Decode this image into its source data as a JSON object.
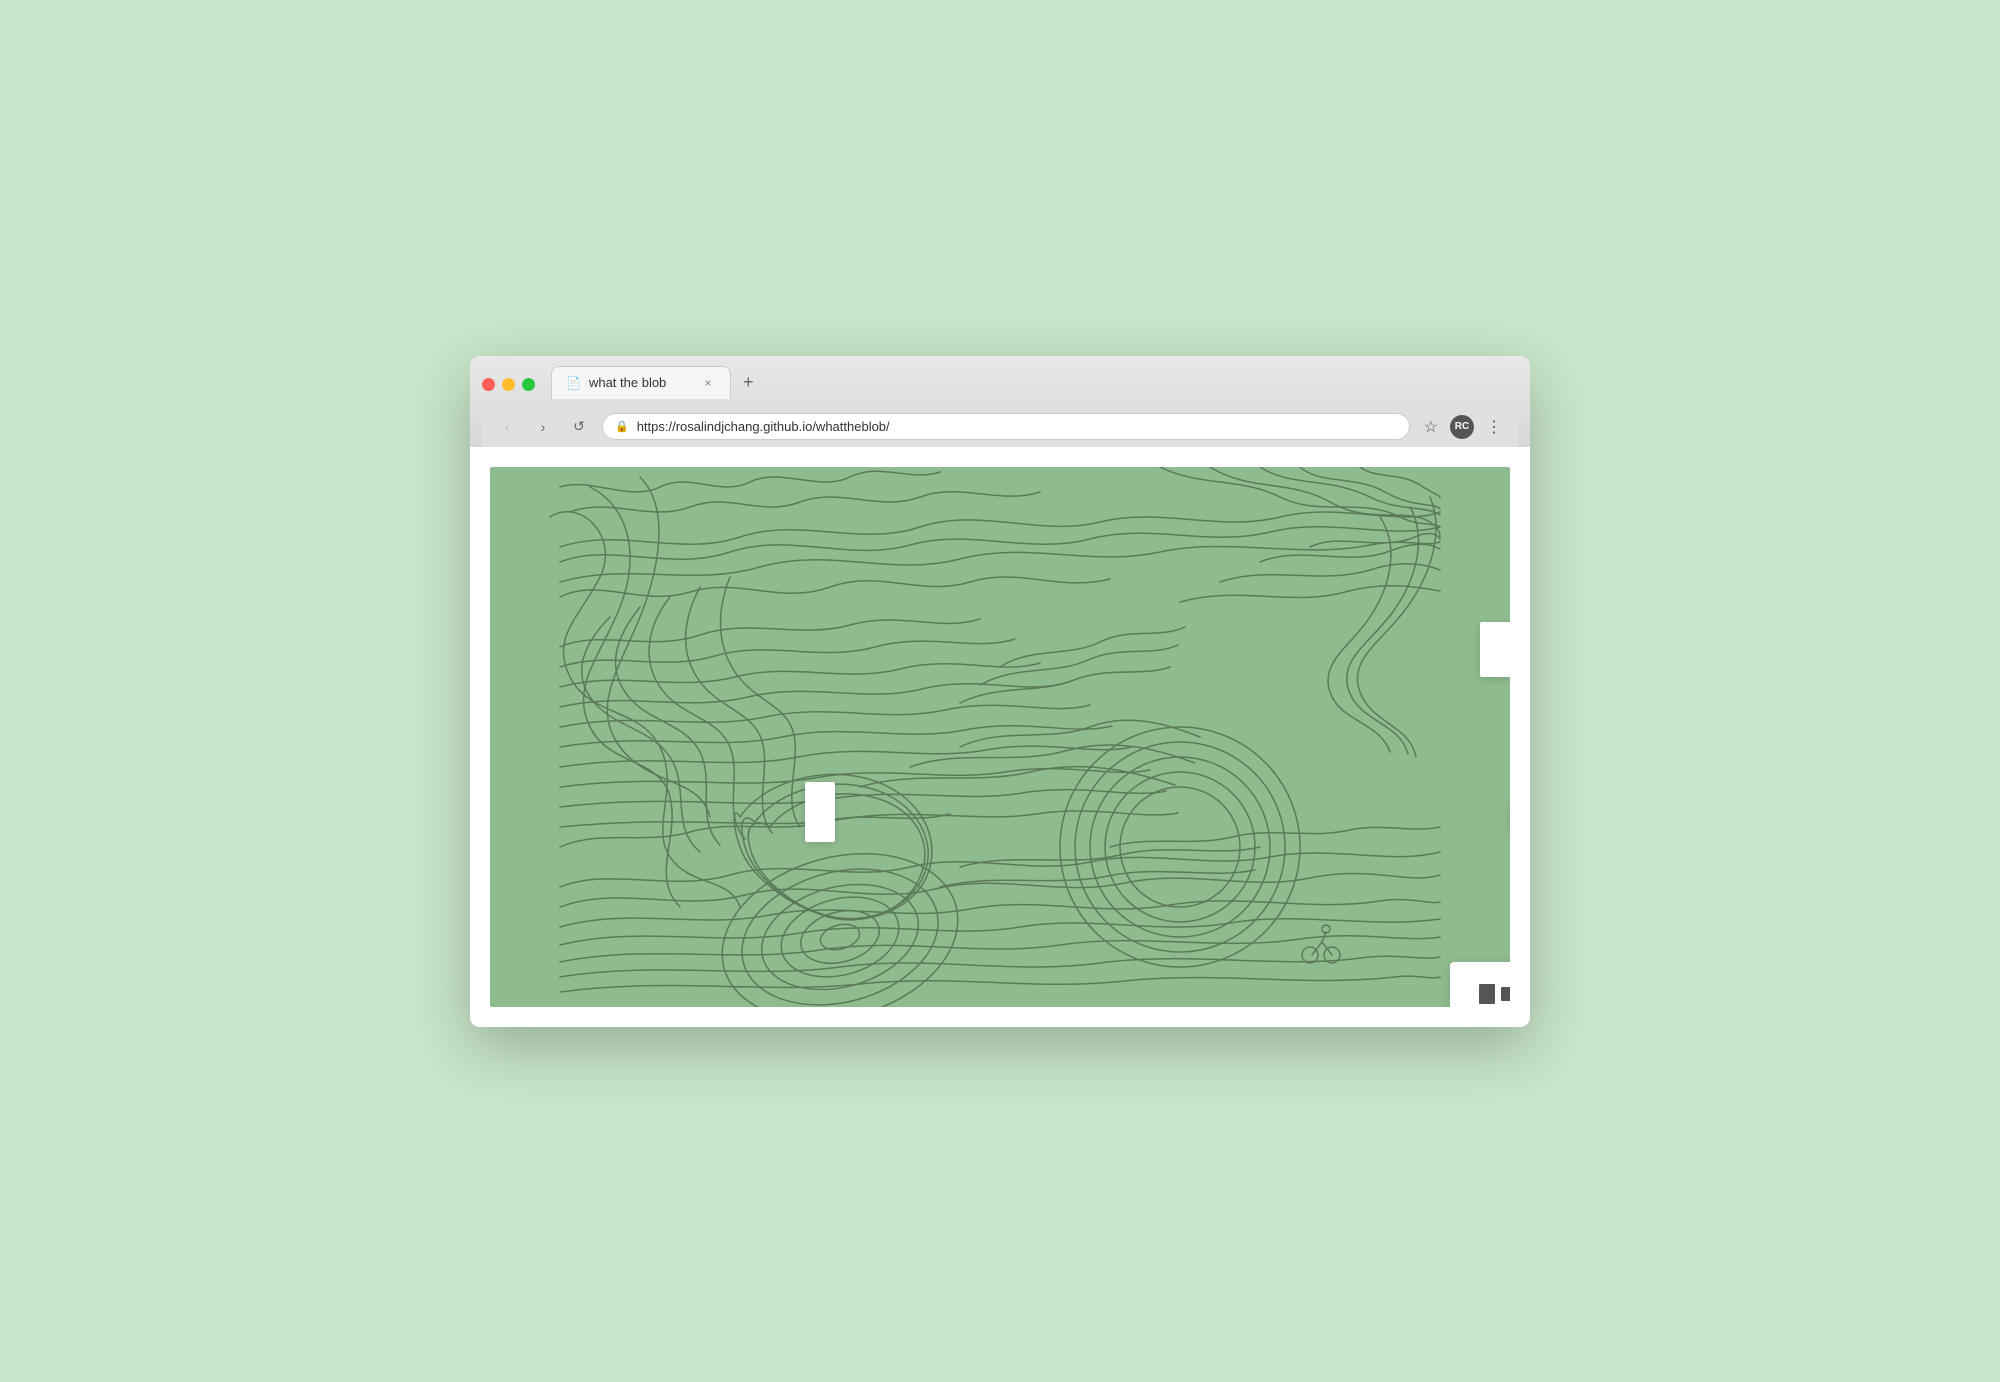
{
  "browser": {
    "background_color": "#c8e6c9",
    "window": {
      "controls": {
        "close_label": "",
        "minimize_label": "",
        "maximize_label": ""
      },
      "tab": {
        "title": "what the blob",
        "icon": "📄",
        "close_label": "×"
      },
      "new_tab_label": "+",
      "address_bar": {
        "url": "https://rosalindjchang.github.io/whattheblob/",
        "lock_icon": "🔒"
      },
      "nav": {
        "back_label": "‹",
        "forward_label": "›",
        "refresh_label": "↺"
      },
      "toolbar": {
        "star_label": "☆",
        "menu_label": "⋮",
        "profile_initials": "RC"
      }
    }
  },
  "webpage": {
    "title": "what the blob",
    "url": "https://rosalindjchang.github.io/whattheblob/",
    "background_color": "#8fbc8f",
    "stroke_color": "#5a7a5a",
    "overlay_panel": {
      "icon1": "document",
      "icon2": "minus"
    }
  }
}
